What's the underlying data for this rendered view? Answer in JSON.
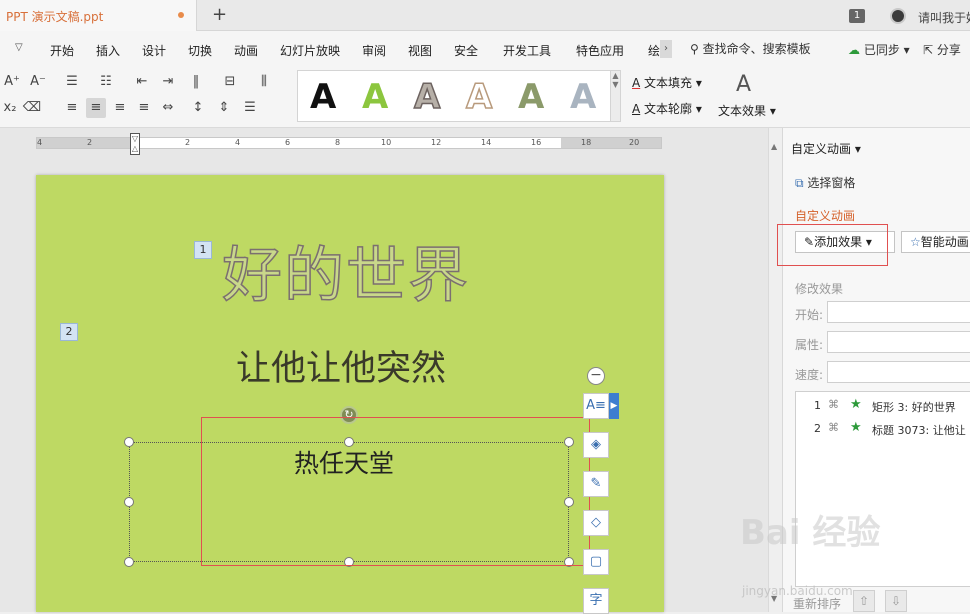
{
  "titlebar": {
    "doc_title": "PPT 演示文稿.ppt",
    "window_count": "1",
    "user_name": "请叫我于好"
  },
  "menu": {
    "items": [
      "开始",
      "插入",
      "设计",
      "切换",
      "动画",
      "幻灯片放映",
      "审阅",
      "视图",
      "安全",
      "开发工具",
      "特色应用",
      "绘"
    ],
    "search": "查找命令、搜索模板",
    "sync": "已同步",
    "share": "分享"
  },
  "ribbon": {
    "text_fill": "文本填充",
    "text_outline": "文本轮廓",
    "text_effect": "文本效果",
    "style_glyph": "A",
    "font_grow": "A⁺",
    "font_shrink": "A⁻"
  },
  "ruler": {
    "ticks": [
      "4",
      "2",
      "2",
      "4",
      "6",
      "8",
      "10",
      "12",
      "14",
      "16",
      "18",
      "20"
    ]
  },
  "slide": {
    "tag1": "1",
    "tag2": "2",
    "title": "好的世界",
    "subtitle": "让他让他突然",
    "textbox": "热任天堂",
    "float_tool_last": "字"
  },
  "pane": {
    "header": "自定义动画",
    "select_pane": "选择窗格",
    "heading": "自定义动画",
    "add_effect": "添加效果",
    "smart_anim": "智能动画",
    "modify_heading": "修改效果",
    "start_label": "开始:",
    "property_label": "属性:",
    "speed_label": "速度:",
    "anim_items": [
      {
        "num": "1",
        "label": "矩形 3: 好的世界"
      },
      {
        "num": "2",
        "label": "标题 3073: 让他让"
      }
    ],
    "reorder": "重新排序"
  },
  "watermark": {
    "logo": "Bai 经验",
    "url": "jingyan.baidu.com"
  },
  "colors": {
    "slide_bg": "#bed963",
    "accent_orange": "#d5612a",
    "highlight_red": "#e05050",
    "star_green": "#2d9a3a"
  }
}
